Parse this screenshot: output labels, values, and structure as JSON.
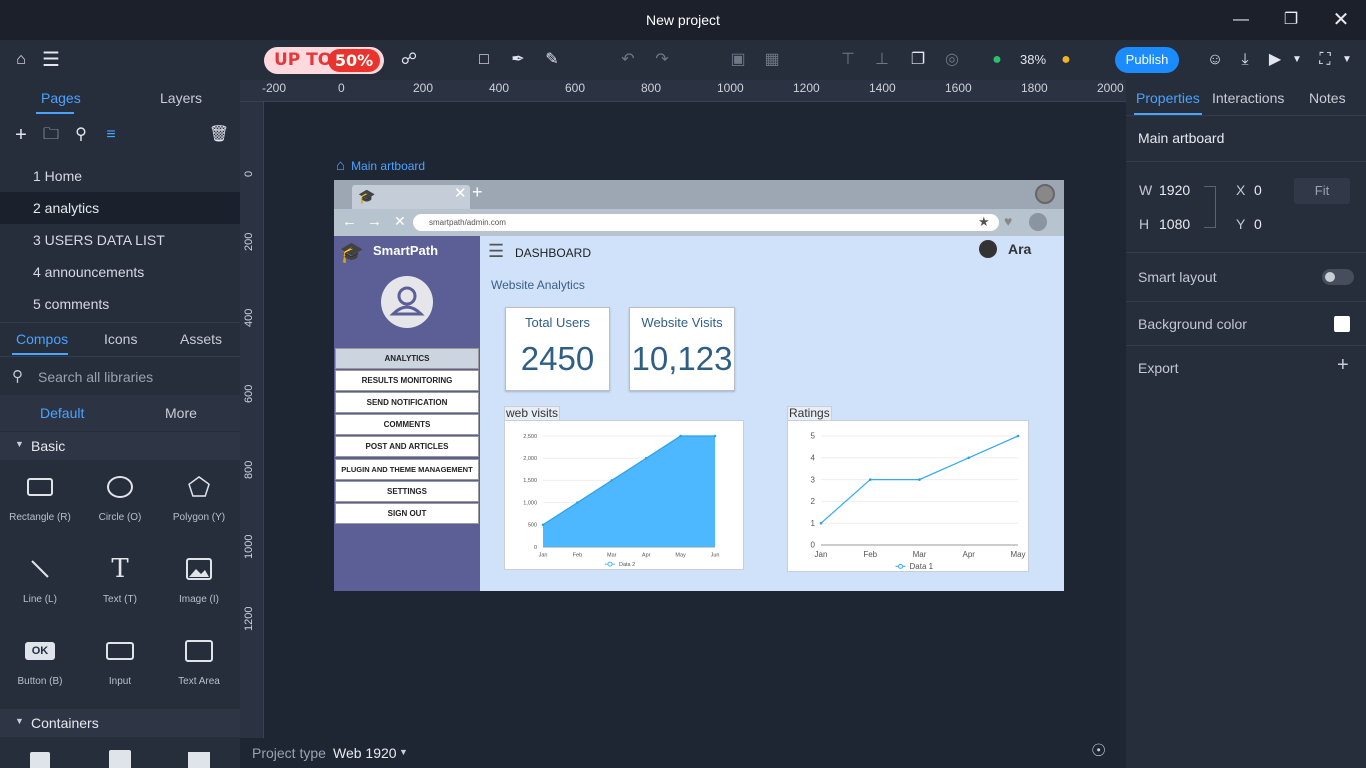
{
  "window": {
    "title": "New project"
  },
  "toolbar": {
    "promo_left": "UP TO",
    "promo_right": "50%",
    "zoom": "38%",
    "publish_label": "Publish"
  },
  "left_panel": {
    "tabs": [
      "Pages",
      "Layers"
    ],
    "pages": [
      "1 Home",
      "2 analytics",
      "3 USERS DATA LIST",
      "4 announcements",
      "5 comments"
    ],
    "comp_tabs": [
      "Compos",
      "Icons",
      "Assets"
    ],
    "search_placeholder": "Search all libraries",
    "lib_tabs": [
      "Default",
      "More"
    ],
    "section_basic": "Basic",
    "components": [
      "Rectangle (R)",
      "Circle (O)",
      "Polygon (Y)",
      "Line (L)",
      "Text (T)",
      "Image (I)",
      "Button (B)",
      "Input",
      "Text Area"
    ],
    "button_icon_text": "OK",
    "section_containers": "Containers"
  },
  "ruler": {
    "h": [
      "-200",
      "0",
      "200",
      "400",
      "600",
      "800",
      "1000",
      "1200",
      "1400",
      "1600",
      "1800",
      "2000"
    ],
    "v": [
      "0",
      "200",
      "400",
      "600",
      "800",
      "1000",
      "1200"
    ]
  },
  "artboard": {
    "label": "Main artboard",
    "url": "smartpath/admin.com",
    "brand": "SmartPath",
    "header_title": "DASHBOARD",
    "user_name": "Ara",
    "section_title": "Website Analytics",
    "menu": [
      "ANALYTICS",
      "RESULTS MONITORING",
      "SEND NOTIFICATION",
      "COMMENTS",
      "POST AND ARTICLES",
      "PLUGIN AND THEME MANAGEMENT",
      "SETTINGS",
      "SIGN OUT"
    ],
    "stats": [
      {
        "label": "Total Users",
        "value": "2450"
      },
      {
        "label": "Website Visits",
        "value": "10,123"
      }
    ]
  },
  "chart_data": [
    {
      "type": "area",
      "title": "web visits",
      "categories": [
        "Jan",
        "Feb",
        "Mar",
        "Apr",
        "May",
        "Jun"
      ],
      "series": [
        {
          "name": "Data 2",
          "values": [
            500,
            1000,
            1500,
            2000,
            2500,
            2500
          ]
        }
      ],
      "y_ticks": [
        "0",
        "500",
        "1,000",
        "1,500",
        "2,000",
        "2,500"
      ],
      "ylim": [
        0,
        2500
      ],
      "color": "#4db8ff"
    },
    {
      "type": "line",
      "title": "Ratings",
      "categories": [
        "Jan",
        "Feb",
        "Mar",
        "Apr",
        "May"
      ],
      "series": [
        {
          "name": "Data 1",
          "values": [
            1,
            3,
            3,
            4,
            5
          ]
        }
      ],
      "y_ticks": [
        "0",
        "1",
        "2",
        "3",
        "4",
        "5"
      ],
      "ylim": [
        0,
        5
      ],
      "color": "#33aaee"
    }
  ],
  "bottom": {
    "project_type_label": "Project type",
    "project_type_value": "Web 1920"
  },
  "right_panel": {
    "tabs": [
      "Properties",
      "Interactions",
      "Notes"
    ],
    "artboard_name": "Main artboard",
    "w_label": "W",
    "w_value": "1920",
    "h_label": "H",
    "h_value": "1080",
    "x_label": "X",
    "x_value": "0",
    "y_label": "Y",
    "y_value": "0",
    "fit_label": "Fit",
    "smart_layout": "Smart layout",
    "background_color": "Background color",
    "export": "Export"
  }
}
